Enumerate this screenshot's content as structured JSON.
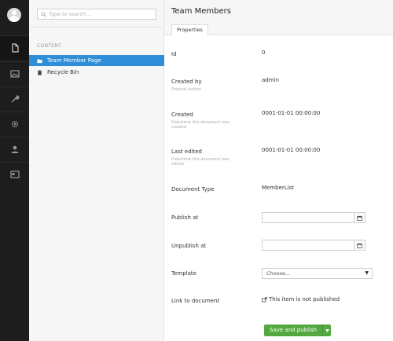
{
  "rail": {
    "items": [
      {
        "icon": "document-icon",
        "active": true
      },
      {
        "icon": "media-icon",
        "active": false
      },
      {
        "icon": "wrench-icon",
        "active": false
      },
      {
        "icon": "gear-icon",
        "active": false
      },
      {
        "icon": "user-icon",
        "active": false
      },
      {
        "icon": "member-card-icon",
        "active": false
      }
    ]
  },
  "tree": {
    "search_placeholder": "Type to search...",
    "section_label": "CONTENT",
    "nodes": [
      {
        "label": "Team Member Page",
        "icon": "folder-icon",
        "selected": true
      },
      {
        "label": "Recycle Bin",
        "icon": "trash-icon",
        "selected": false
      }
    ]
  },
  "editor": {
    "document_name": "Team Members",
    "tabs": [
      {
        "label": "Properties"
      }
    ],
    "properties": {
      "id": {
        "label": "Id",
        "value": "0"
      },
      "created_by": {
        "label": "Created by",
        "description": "Original author",
        "value": "admin"
      },
      "created": {
        "label": "Created",
        "description": "Date/time this document was created",
        "value": "0001-01-01 00:00:00"
      },
      "last_edited": {
        "label": "Last edited",
        "description": "Date/time this document was edited",
        "value": "0001-01-01 00:00:00"
      },
      "document_type": {
        "label": "Document Type",
        "value": "MemberList"
      },
      "publish_at": {
        "label": "Publish at",
        "value": ""
      },
      "unpublish_at": {
        "label": "Unpublish at",
        "value": ""
      },
      "template": {
        "label": "Template",
        "selected": "Choose..."
      },
      "link": {
        "label": "Link to document",
        "value": "This item is not published"
      }
    },
    "actions": {
      "save_publish": "Save and publish"
    },
    "colors": {
      "accent": "#2e8fd8",
      "success": "#53a93f",
      "rail": "#1d1d1d"
    }
  }
}
